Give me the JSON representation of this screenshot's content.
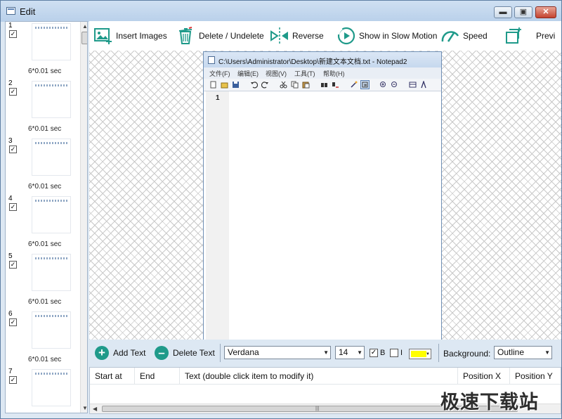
{
  "window": {
    "title": "Edit",
    "controls": {
      "minimize": "▬",
      "maximize": "▣",
      "close": "✕"
    }
  },
  "filmstrip": {
    "frames": [
      {
        "number": "1",
        "checked": true,
        "duration": "6*0.01 sec"
      },
      {
        "number": "2",
        "checked": true,
        "duration": "6*0.01 sec"
      },
      {
        "number": "3",
        "checked": true,
        "duration": "6*0.01 sec"
      },
      {
        "number": "4",
        "checked": true,
        "duration": "6*0.01 sec"
      },
      {
        "number": "5",
        "checked": true,
        "duration": "6*0.01 sec"
      },
      {
        "number": "6",
        "checked": true,
        "duration": "6*0.01 sec"
      },
      {
        "number": "7",
        "checked": true,
        "duration": ""
      }
    ]
  },
  "toolbar": {
    "insert_images": "Insert Images",
    "delete_undelete": "Delete / Undelete",
    "reverse": "Reverse",
    "slow_motion": "Show in Slow Motion",
    "speed": "Speed",
    "preview": "Previ",
    "icon_color": "#1f9a8a"
  },
  "preview_image": {
    "title": "C:\\Users\\Administrator\\Desktop\\新建文本文档.txt - Notepad2",
    "menu": [
      "文件(F)",
      "编辑(E)",
      "视图(V)",
      "工具(T)",
      "帮助(H)"
    ],
    "line_number": "1"
  },
  "textbar": {
    "add_text": "Add Text",
    "delete_text": "Delete Text",
    "font": "Verdana",
    "size": "14",
    "bold_checked": true,
    "bold_label": "B",
    "italic_checked": false,
    "italic_label": "I",
    "text_color": "#ffff00",
    "background_label": "Background:",
    "background_value": "Outline"
  },
  "table": {
    "columns": [
      "Start at",
      "End",
      "Text (double click item to modify it)",
      "Position X",
      "Position Y"
    ],
    "rows": []
  },
  "watermark": "极速下载站"
}
